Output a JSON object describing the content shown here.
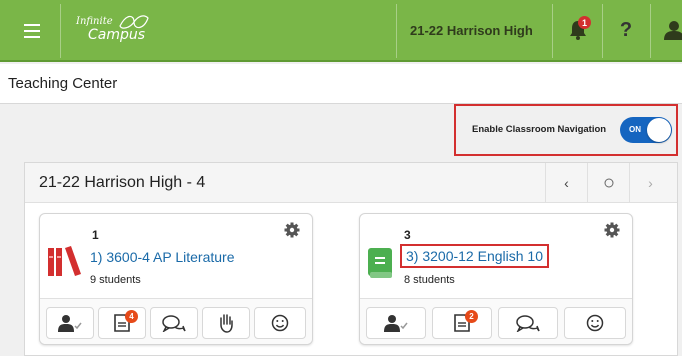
{
  "topbar": {
    "menu_icon": "hamburger-icon",
    "logo_line1": "Infinite",
    "logo_line2": "Campus",
    "school": "21-22 Harrison High",
    "notification_count": "1",
    "help_icon": "question-icon",
    "user_icon": "person-icon",
    "colors": {
      "bar": "#7ab648",
      "badge": "#d32f2f"
    }
  },
  "page": {
    "title": "Teaching Center"
  },
  "classroom_nav": {
    "label": "Enable Classroom Navigation",
    "toggle_text": "ON",
    "enabled": true,
    "highlight_color": "#d32f2f"
  },
  "section": {
    "title": "21-22 Harrison High - 4",
    "prev_icon": "chevron-left-icon",
    "current_icon": "circle-icon",
    "next_icon": "chevron-right-icon"
  },
  "cards": [
    {
      "number": "1",
      "title": "1) 3600-4 AP Literature",
      "students": "9 students",
      "icon": "books-red-icon",
      "tools": [
        {
          "icon": "roster-check-icon"
        },
        {
          "icon": "gradebook-icon",
          "badge": "4"
        },
        {
          "icon": "messages-icon"
        },
        {
          "icon": "raise-hand-icon"
        },
        {
          "icon": "smiley-icon"
        }
      ]
    },
    {
      "number": "3",
      "title": "3) 3200-12 English 10",
      "students": "8 students",
      "icon": "book-green-icon",
      "tools": [
        {
          "icon": "roster-check-icon"
        },
        {
          "icon": "gradebook-icon",
          "badge": "2"
        },
        {
          "icon": "messages-icon"
        },
        {
          "icon": "smiley-icon"
        }
      ]
    }
  ]
}
